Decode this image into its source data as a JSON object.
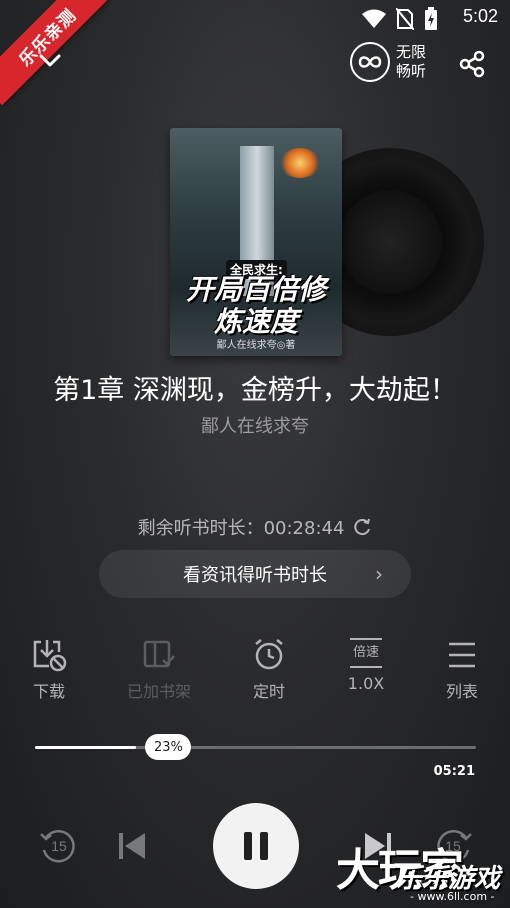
{
  "status": {
    "time": "5:02"
  },
  "watermark": {
    "ribbon": "乐乐亲测",
    "site_cn": "大玩家",
    "site_sub": "乐乐游戏",
    "url": "- www.6ll.com -"
  },
  "header": {
    "unlimited_label": "无限畅听"
  },
  "book": {
    "cover_badge": "全民求生:",
    "cover_title": "开局百倍修炼速度",
    "cover_author": "鄙人在线求夸◎著",
    "chapter_title": "第1章 深渊现，金榜升，大劫起！",
    "author": "鄙人在线求夸"
  },
  "listening": {
    "remaining_label": "剩余听书时长：00:28:44",
    "earn_button": "看资讯得听书时长"
  },
  "actions": [
    {
      "label": "下载",
      "icon": "download-icon",
      "enabled": true
    },
    {
      "label": "已加书架",
      "icon": "bookshelf-icon",
      "enabled": false
    },
    {
      "label": "定时",
      "icon": "alarm-clock-icon",
      "enabled": true
    },
    {
      "label": "1.0X",
      "icon": "speed-icon",
      "icon_text": "倍速",
      "enabled": true
    },
    {
      "label": "列表",
      "icon": "list-icon",
      "enabled": true
    }
  ],
  "progress": {
    "percent_label": "23%",
    "fraction": 0.23,
    "duration": "05:21"
  },
  "playback": {
    "rewind_label": "15",
    "forward_label": "15",
    "state": "playing"
  }
}
